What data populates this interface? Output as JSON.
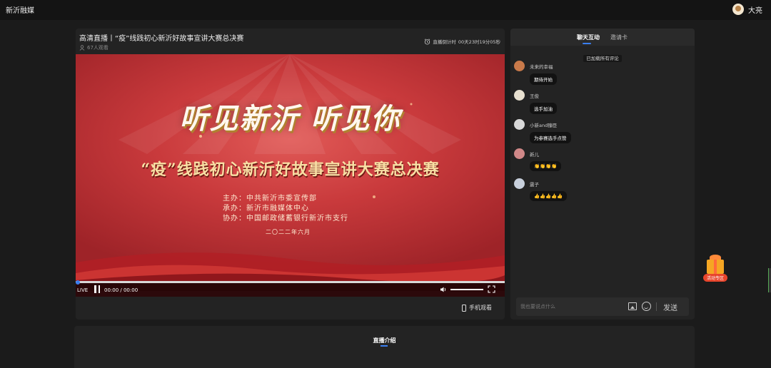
{
  "header": {
    "brand": "新沂融媒",
    "username": "大亮"
  },
  "stream": {
    "title": "高清直播丨“疫”线践初心新沂好故事宣讲大赛总决赛",
    "viewers": "67人观看",
    "countdown_label": "直播倒计时",
    "countdown_value": "00天23时19分05秒"
  },
  "video": {
    "calligraphy": "听见新沂 听见你",
    "subtitle": "“疫”线践初心新沂好故事宣讲大赛总决赛",
    "sponsors": [
      "主办：中共新沂市委宣传部",
      "承办：新沂市融媒体中心",
      "协办：中国邮政储蓄银行新沂市支行"
    ],
    "date": "二〇二二年六月"
  },
  "player": {
    "live_label": "LIVE",
    "time": "00:00 / 00:00",
    "progress": 0.0,
    "volume": 1.0,
    "mobile_watch": "手机观看"
  },
  "chat": {
    "tabs": [
      {
        "label": "聊天互动",
        "active": true
      },
      {
        "label": "邀请卡",
        "active": false
      }
    ],
    "notice": "已加载所有评论",
    "messages": [
      {
        "name": "未来的幸福",
        "text": "期待开始",
        "avatar_color": "#c97a4a"
      },
      {
        "name": "王俊",
        "text": "选手加油",
        "avatar_color": "#e8e0d0"
      },
      {
        "name": "小新and臻臣",
        "text": "为参赛选手点赞",
        "avatar_color": "#d8d8d8"
      },
      {
        "name": "新儿",
        "text": "👏👏👏👏",
        "avatar_color": "#d08888"
      },
      {
        "name": "震子",
        "text": "👍👍👍👍👍",
        "avatar_color": "#c8d0dc"
      }
    ],
    "input_placeholder": "我也要说点什么",
    "send_label": "发送"
  },
  "gift": {
    "label": "活动专区"
  },
  "intro": {
    "tab_label": "直播介绍"
  },
  "colors": {
    "accent": "#3a7ff0",
    "panel": "#232323",
    "background": "#1b1b1b"
  }
}
